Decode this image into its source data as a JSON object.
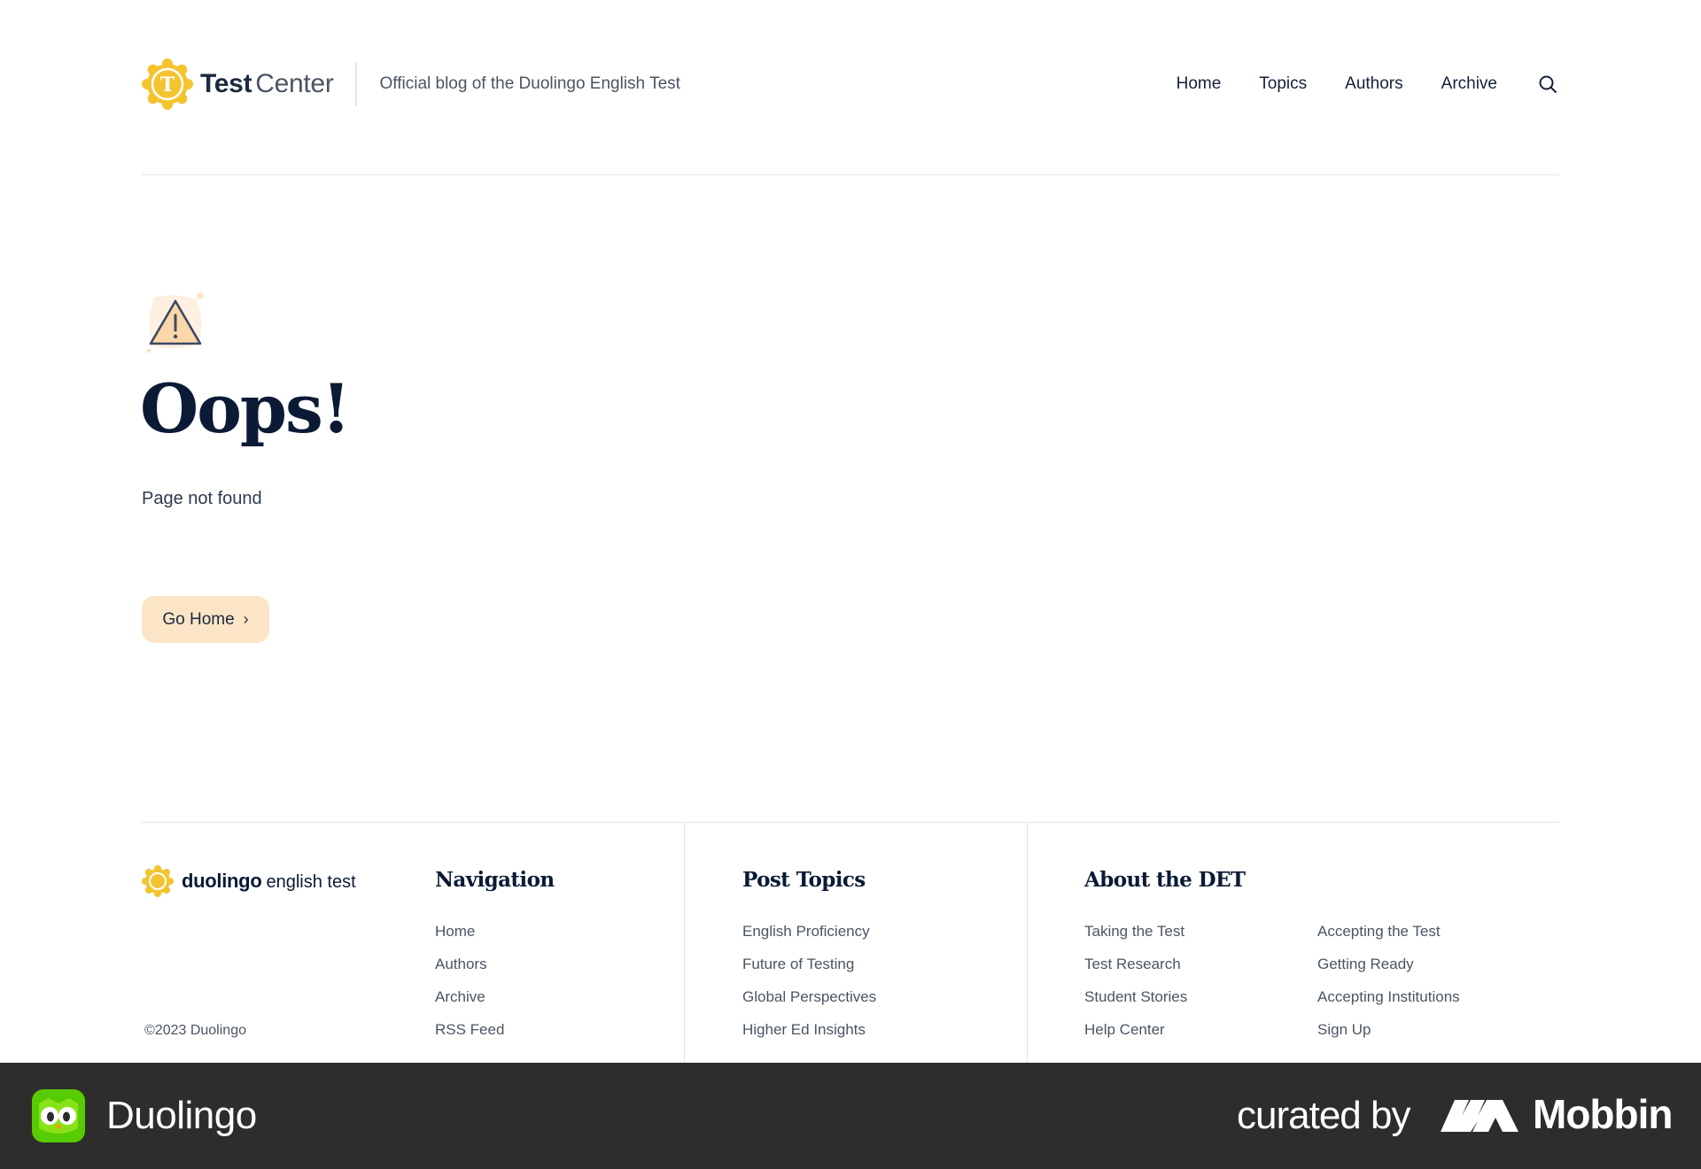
{
  "header": {
    "brand_bold": "Test",
    "brand_regular": "Center",
    "tagline": "Official blog of the Duolingo English Test",
    "nav": [
      {
        "label": "Home"
      },
      {
        "label": "Topics"
      },
      {
        "label": "Authors"
      },
      {
        "label": "Archive"
      }
    ],
    "search_icon": "search-icon"
  },
  "main": {
    "icon": "warning-icon",
    "title": "Oops!",
    "subtitle": "Page not found",
    "button_label": "Go Home",
    "button_chevron": "›"
  },
  "footer": {
    "brand_bold": "duolingo",
    "brand_regular": "english test",
    "copyright": "©2023 Duolingo",
    "navigation": {
      "title": "Navigation",
      "items": [
        "Home",
        "Authors",
        "Archive",
        "RSS Feed"
      ]
    },
    "post_topics": {
      "title": "Post Topics",
      "items": [
        "English Proficiency",
        "Future of Testing",
        "Global Perspectives",
        "Higher Ed Insights"
      ]
    },
    "about": {
      "title": "About the DET",
      "col1": [
        "Taking the Test",
        "Test Research",
        "Student Stories",
        "Help Center"
      ],
      "col2": [
        "Accepting the Test",
        "Getting Ready",
        "Accepting Institutions",
        "Sign Up"
      ]
    }
  },
  "bottom_bar": {
    "app_name": "Duolingo",
    "curated_by": "curated by",
    "mobbin": "Mobbin"
  },
  "colors": {
    "brand_yellow": "#f4c430",
    "button_bg": "#fbe5c6",
    "text_dark": "#0b1b36",
    "text_muted": "#4b5563",
    "bottom_bar": "#2d2d2d",
    "duolingo_green": "#58cc02"
  }
}
